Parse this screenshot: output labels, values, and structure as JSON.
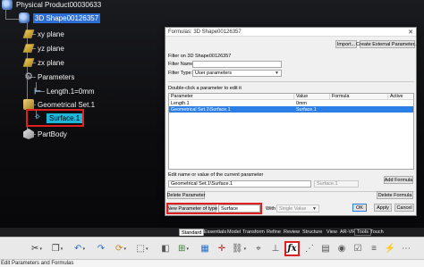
{
  "tree": {
    "root_label": "Physical Product00030633",
    "shape_label": "3D Shape00126357",
    "planes": [
      "xy plane",
      "yz plane",
      "zx plane"
    ],
    "parameters_label": "Parameters",
    "param_item": "Length.1=0mm",
    "geoset_label": "Geometrical Set.1",
    "surface_label": "Surface.1",
    "partbody_label": "PartBody"
  },
  "dialog": {
    "title": "Formulas: 3D Shape00126357",
    "import_label": "Import...",
    "create_external_label": "Create External Parameter...",
    "filter_on_label": "Filter on 3D Shape00126357",
    "filter_name_label": "Filter Name:",
    "filter_name_value": "",
    "filter_type_label": "Filter Type:",
    "filter_type_value": "User parameters",
    "doubleclick_label": "Double-click a parameter to edit it",
    "table": {
      "headers": [
        "Parameter",
        "Value",
        "Formula",
        "Active"
      ],
      "rows": [
        {
          "parameter": "Length.1",
          "value": "0mm",
          "formula": "",
          "active": ""
        },
        {
          "parameter": "Geometrical Set.1\\Surface.1",
          "value": "Surface.1",
          "formula": "",
          "active": ""
        }
      ]
    },
    "edit_label": "Edit name or value of the current parameter",
    "edit_name": "Geometrical Set.1\\Surface.1",
    "edit_value": "Surface.1",
    "new_param_label": "New Parameter of type",
    "new_param_type": "Surface",
    "with_label": "With",
    "with_value": "Single Value",
    "add_formula_label": "Add Formula",
    "delete_parameter_label": "Delete Parameter",
    "delete_formula_label": "Delete Formula",
    "ok_label": "OK",
    "apply_label": "Apply",
    "cancel_label": "Cancel"
  },
  "tabs": [
    "Standard",
    "Essentials",
    "Model",
    "Transform",
    "Refine",
    "Review",
    "Structure",
    "View",
    "AR-VR",
    "Tools",
    "Touch"
  ],
  "active_tab": "Standard",
  "status_text": "Edit Parameters and Formulas",
  "icons": [
    "cut-icon",
    "copy-icon",
    "paste-icon",
    "undo-icon",
    "redo-icon",
    "update-icon",
    "select-icon",
    "link-icon",
    "fx-formula-icon"
  ],
  "colors": {
    "selection_blue": "#2b6fd6",
    "highlight_red": "#e02020",
    "surface_cyan": "#1fb7d8"
  }
}
